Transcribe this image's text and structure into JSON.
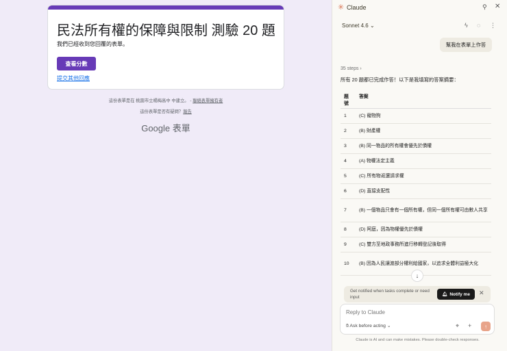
{
  "form": {
    "title": "民法所有權的保障與限制 測驗 20 題",
    "message": "我們已經收到您回覆的表單。",
    "score_button": "查看分數",
    "submit_another": "提交其他回應",
    "footer_text": "這份表單是在 桃園市立楊梅高中 中建立。",
    "footer_sep": " - ",
    "footer_link": "聯絡表單擁有者",
    "report_text": "這份表單是否有疑問？",
    "report_link": "報告",
    "brand": "Google 表單"
  },
  "panel": {
    "app_title": "Claude",
    "model": "Sonnet 4.6",
    "user_message": "幫我在表單上作答",
    "steps": "35 steps",
    "intro": "所有 20 題都已完成作答！以下是我填寫的答案摘要：",
    "table_headers": [
      "題號",
      "答案"
    ],
    "answers": [
      {
        "n": "1",
        "a": "(C) 寵物狗"
      },
      {
        "n": "2",
        "a": "(B) 財產權"
      },
      {
        "n": "3",
        "a": "(B) 同一物品的所有權會優先於債權"
      },
      {
        "n": "4",
        "a": "(A) 物權法定主義"
      },
      {
        "n": "5",
        "a": "(C) 所有物返還請求權"
      },
      {
        "n": "6",
        "a": "(D) 直接支配性"
      },
      {
        "n": "7",
        "a": "(B) 一個物品只會有一個所有權，但同一個所有權可由數人共享"
      },
      {
        "n": "8",
        "a": "(D) 阿庭，因為物權優先於債權"
      },
      {
        "n": "9",
        "a": "(C) 雙方至地政事務所進行移轉登記後取得"
      },
      {
        "n": "10",
        "a": "(B) 因為人民讓渡部分權利給國家，以追求全體利益極大化"
      }
    ],
    "notify_text": "Get notified when tasks complete or need input",
    "notify_button": "Notify me",
    "composer_placeholder": "Reply to Claude",
    "ask_mode": "Ask before acting",
    "disclaimer": "Claude is AI and can make mistakes. Please double-check responses."
  }
}
